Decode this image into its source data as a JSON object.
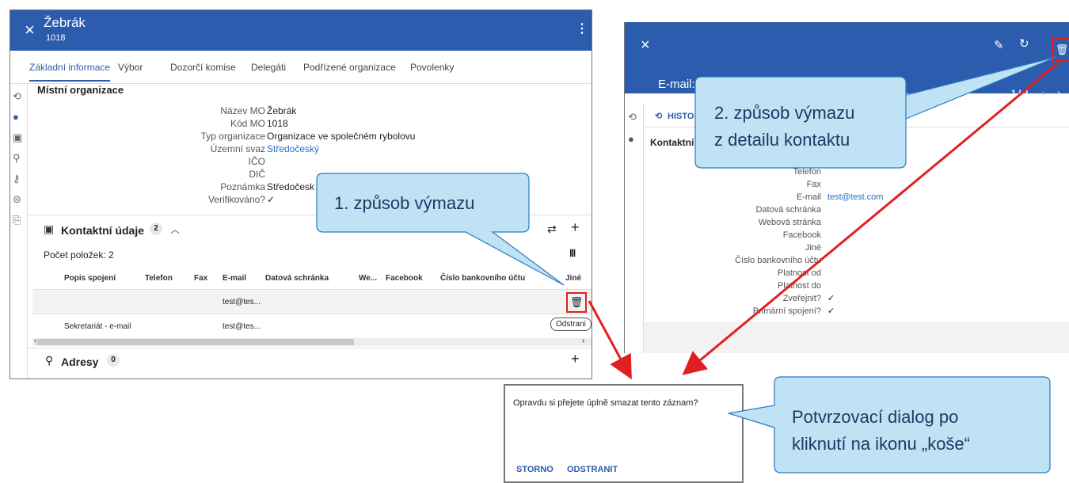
{
  "left_window": {
    "close_icon": "close-icon",
    "title": "Žebrák",
    "subtitle": "1018",
    "menu_icon": "more-vertical-icon",
    "tabs": [
      "Základní informace",
      "Výbor",
      "Dozorčí komise",
      "Delegáti",
      "Podřízené organizace",
      "Povolenky"
    ],
    "section_title": "Místní organizace",
    "fields": [
      {
        "label": "Název MO",
        "value": "Žebrák"
      },
      {
        "label": "Kód MO",
        "value": "1018"
      },
      {
        "label": "Typ organizace",
        "value": "Organizace ve společném rybolovu"
      },
      {
        "label": "Územní svaz",
        "value": "Středočeský"
      },
      {
        "label": "IČO",
        "value": ""
      },
      {
        "label": "DIČ",
        "value": ""
      },
      {
        "label": "Poznámka",
        "value": "Středočesk"
      },
      {
        "label": "Verifikováno?",
        "value": "✓"
      }
    ],
    "contacts": {
      "title": "Kontaktní údaje",
      "count": "2",
      "items_count": "Počet položek: 2",
      "columns": [
        "Popis spojení",
        "Telefon",
        "Fax",
        "E-mail",
        "Datová schránka",
        "We...",
        "Facebook",
        "Číslo bankovního účtu",
        "Jiné"
      ],
      "rows": [
        {
          "popis": "",
          "email": "test@tes..."
        },
        {
          "popis": "Sekretariát - e-mail",
          "email": "test@tes..."
        }
      ],
      "delete_tooltip": "Odstrani"
    },
    "addresses": {
      "title": "Adresy",
      "count": "0"
    }
  },
  "right_window": {
    "email_label": "E-mail:",
    "pager": "1 / 2",
    "history_label": "HISTO",
    "section_title": "Kontaktní",
    "fields": [
      {
        "label": "Telefon",
        "value": ""
      },
      {
        "label": "Fax",
        "value": ""
      },
      {
        "label": "E-mail",
        "value": "test@test.com"
      },
      {
        "label": "Datová schránka",
        "value": ""
      },
      {
        "label": "Webová stránka",
        "value": ""
      },
      {
        "label": "Facebook",
        "value": ""
      },
      {
        "label": "Jiné",
        "value": ""
      },
      {
        "label": "Číslo bankovního účtu",
        "value": ""
      },
      {
        "label": "Platnost od",
        "value": ""
      },
      {
        "label": "Platnost do",
        "value": ""
      },
      {
        "label": "Zveřejnit?",
        "value": "✓"
      },
      {
        "label": "Primární spojení?",
        "value": "✓"
      }
    ]
  },
  "dialog": {
    "message": "Opravdu si přejete úplně smazat tento záznam?",
    "cancel": "STORNO",
    "confirm": "ODSTRANIT"
  },
  "callouts": {
    "one": "1. způsob výmazu",
    "two_line1": "2. způsob výmazu",
    "two_line2": "z detailu kontaktu",
    "three_line1": "Potvrzovací dialog po",
    "three_line2": "kliknutí na ikonu „koše“"
  },
  "colors": {
    "header": "#2b5cad",
    "callout": "#bfe3f5",
    "arrow": "#e02020",
    "link": "#2b6cc4"
  }
}
